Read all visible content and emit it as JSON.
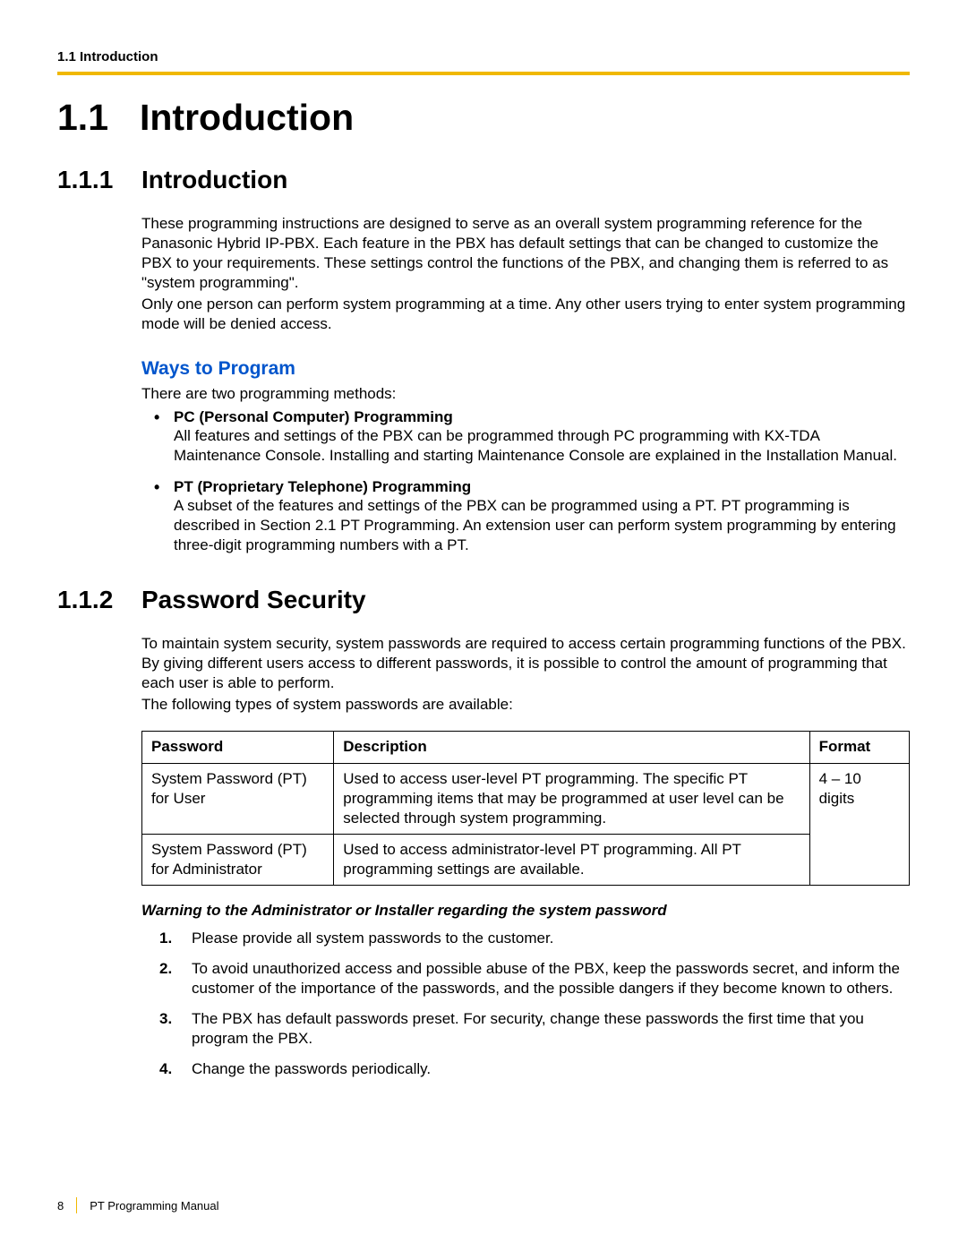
{
  "header": {
    "running": "1.1 Introduction"
  },
  "h1": {
    "number": "1.1",
    "title": "Introduction"
  },
  "s1": {
    "number": "1.1.1",
    "title": "Introduction",
    "para1": "These programming instructions are designed to serve as an overall system programming reference for the Panasonic Hybrid IP-PBX. Each feature in the PBX has default settings that can be changed to customize the PBX to your requirements. These settings control the functions of the PBX, and changing them is referred to as \"system programming\".",
    "para2": "Only one person can perform system programming at a time. Any other users trying to enter system programming mode will be denied access.",
    "ways_title": "Ways to Program",
    "ways_intro": "There are two programming methods:",
    "bullets": [
      {
        "title": "PC (Personal Computer) Programming",
        "body": "All features and settings of the PBX can be programmed through PC programming with KX-TDA Maintenance Console. Installing and starting Maintenance Console are explained in the Installation Manual."
      },
      {
        "title": "PT (Proprietary Telephone) Programming",
        "body": "A subset of the features and settings of the PBX can be programmed using a PT. PT programming is described in Section 2.1 PT Programming. An extension user can perform system programming by entering three-digit programming numbers with a PT."
      }
    ]
  },
  "s2": {
    "number": "1.1.2",
    "title": "Password Security",
    "para1": "To maintain system security, system passwords are required to access certain programming functions of the PBX. By giving different users access to different passwords, it is possible to control the amount of programming that each user is able to perform.",
    "para2": "The following types of system passwords are available:",
    "table": {
      "headers": {
        "c1": "Password",
        "c2": "Description",
        "c3": "Format"
      },
      "rows": [
        {
          "c1": "System Password (PT) for User",
          "c2": "Used to access user-level PT programming. The specific PT programming items that may be programmed at user level can be selected through system programming."
        },
        {
          "c1": "System Password (PT) for Administrator",
          "c2": "Used to access administrator-level PT programming. All PT programming settings are available."
        }
      ],
      "format": "4 – 10 digits"
    },
    "warning_title": "Warning to the Administrator or Installer regarding the system password",
    "warnings": [
      {
        "n": "1.",
        "text": "Please provide all system passwords to the customer."
      },
      {
        "n": "2.",
        "text": "To avoid unauthorized access and possible abuse of the PBX, keep the passwords secret, and inform the customer of the importance of the passwords, and the possible dangers if they become known to others."
      },
      {
        "n": "3.",
        "text": "The PBX has default passwords preset. For security, change these passwords the first time that you program the PBX."
      },
      {
        "n": "4.",
        "text": "Change the passwords periodically."
      }
    ]
  },
  "footer": {
    "page": "8",
    "title": "PT Programming Manual"
  }
}
